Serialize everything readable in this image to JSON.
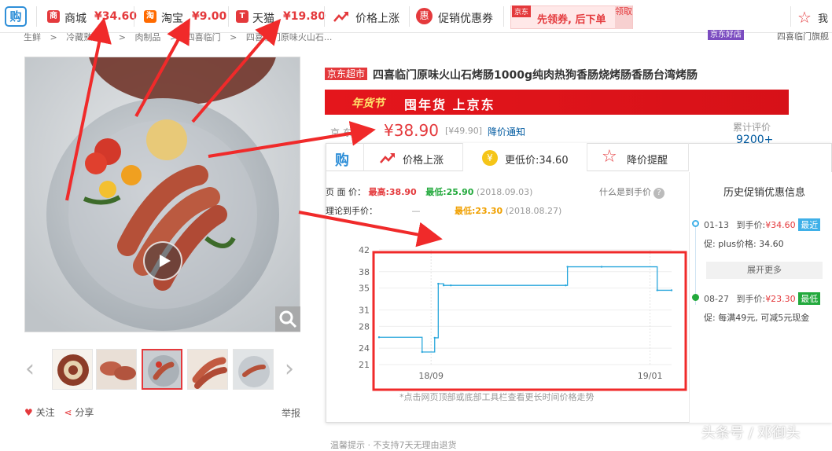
{
  "toolbar": {
    "logo": "购",
    "items": [
      {
        "icon": "商",
        "label": "商城",
        "price": "¥34.60",
        "color": "#e4393c"
      },
      {
        "icon": "淘",
        "label": "淘宝",
        "price": "¥9.00",
        "color": "#ff6a00"
      },
      {
        "icon": "T",
        "label": "天猫",
        "price": "¥19.80",
        "color": "#e4393c"
      }
    ],
    "price_up_label": "价格上涨",
    "coupon_icon": "惠",
    "coupon_label": "促销优惠券",
    "coupon_tag": "京东",
    "coupon_text": "先领券, 后下单",
    "coupon_claim": "领取",
    "fav_label": "我"
  },
  "breadcrumb": {
    "items": [
      "生鲜",
      "冷藏熟食品",
      "肉制品",
      "四喜临门",
      "四喜临门原味火山石..."
    ],
    "store_badge": "京东好店",
    "shop": "四喜临门旗舰"
  },
  "product": {
    "tag": "京东超市",
    "title": "四喜临门原味火山石烤肠1000g纯肉热狗香肠烧烤肠香肠台湾烤肠",
    "banner_label": "年货节",
    "banner_text": "囤年货 上京东",
    "price_label": "京 东 价",
    "price": "¥38.90",
    "old_price": "[¥49.90]",
    "notify": "降价通知",
    "review_label": "累计评价",
    "review_count": "9200+"
  },
  "gallery": {
    "follow": "关注",
    "share": "分享",
    "report": "举报"
  },
  "panel": {
    "tabs": [
      {
        "name": "tab-gou",
        "label": "购"
      },
      {
        "name": "tab-price-up",
        "label": "价格上涨"
      },
      {
        "name": "tab-lower-price",
        "label": "更低价:34.60"
      },
      {
        "name": "tab-price-alert",
        "label": "降价提醒"
      }
    ],
    "page_price_label": "页  面  价：",
    "page_high": "最高:38.90",
    "page_low": "最低:25.90",
    "page_low_date": "(2018.09.03)",
    "theory_label": "理论到手价：",
    "theory_dash": "—",
    "theory_low": "最低:23.30",
    "theory_low_date": "(2018.08.27)",
    "help": "什么是到手价",
    "chart_hint": "*点击网页顶部或底部工具栏查看更长时间价格走势"
  },
  "history": {
    "title": "历史促销优惠信息",
    "entries": [
      {
        "date": "01-13",
        "label": "到手价:",
        "price": "¥34.60",
        "badge": "最近",
        "badge_color": "#3fb0e8",
        "promo": "促: plus价格: 34.60"
      },
      {
        "date": "08-27",
        "label": "到手价:",
        "price": "¥23.30",
        "badge": "最低",
        "badge_color": "#22a93c",
        "promo": "促: 每满49元, 可减5元现金"
      }
    ],
    "more": "展开更多"
  },
  "footer": {
    "warm": "温馨提示    · 不支持7天无理由退货",
    "watermark": "头条号 / 邓御头"
  },
  "chart_data": {
    "type": "line",
    "title": "",
    "xlabel": "",
    "ylabel": "",
    "xticks": [
      "18/09",
      "19/01"
    ],
    "yticks": [
      21,
      24,
      28,
      31,
      35,
      38,
      42
    ],
    "ylim": [
      21,
      42
    ],
    "x": [
      "2018-08-03",
      "2018-08-27",
      "2018-09-03",
      "2018-09-05",
      "2018-09-08",
      "2018-09-12",
      "2018-11-15",
      "2018-11-16",
      "2018-12-05",
      "2019-01-05",
      "2019-01-13"
    ],
    "series": [
      {
        "values": [
          26,
          23.3,
          25.9,
          35.8,
          35.5,
          35.5,
          35.5,
          38.9,
          38.9,
          34.6,
          34.6
        ]
      }
    ],
    "line_color": "#2aa7dc",
    "grid": true
  }
}
